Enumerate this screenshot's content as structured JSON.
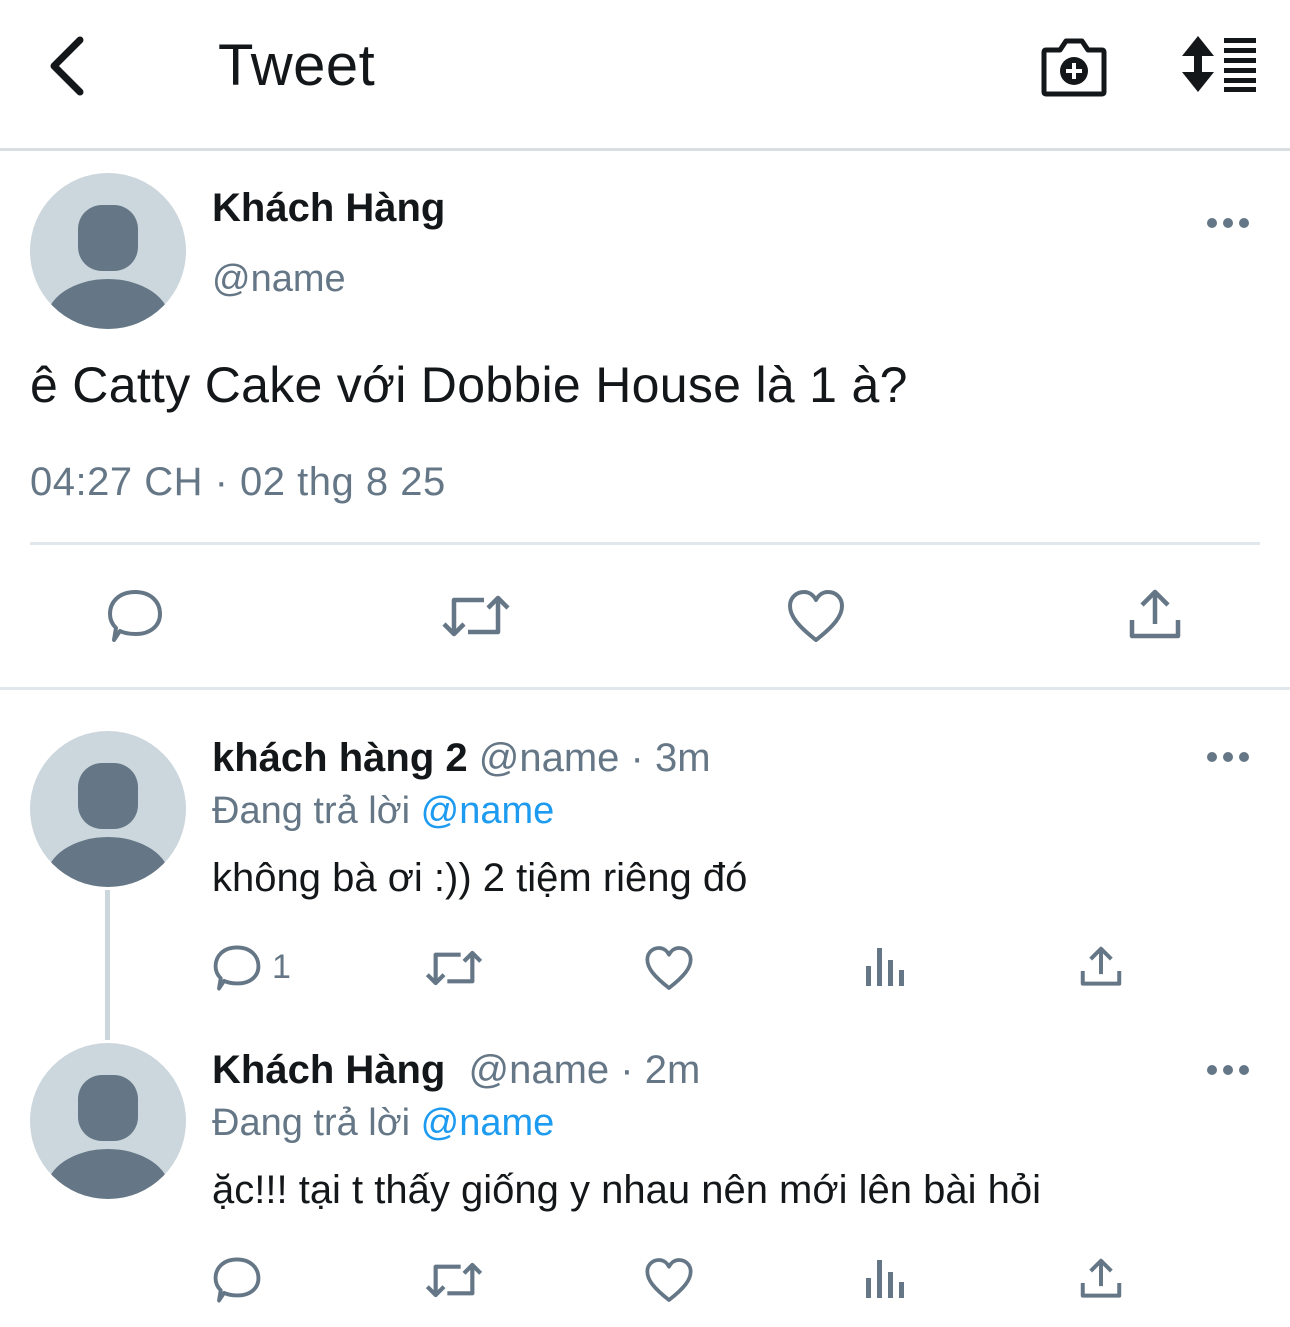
{
  "header": {
    "title": "Tweet",
    "back_icon": "chevron-left-icon",
    "camera_icon": "camera-add-icon",
    "sort_icon": "sort-lines-icon"
  },
  "main_tweet": {
    "name": "Khách Hàng",
    "handle": "@name",
    "text": "ê Catty Cake với Dobbie House là 1 à?",
    "timestamp": "04:27 CH · 02 thg 8 25"
  },
  "replies": [
    {
      "name": "khách hàng 2",
      "handle": "@name",
      "time": "· 3m",
      "replying_label": "Đang trả lời",
      "replying_to": "@name",
      "text": "không bà ơi :)) 2 tiệm riêng đó",
      "reply_count": "1"
    },
    {
      "name": "Khách Hàng",
      "handle": "@name",
      "time": "· 2m",
      "replying_label": "Đang trả lời",
      "replying_to": "@name",
      "text": "ặc!!! tại t thấy giống y nhau nên mới lên bài hỏi",
      "reply_count": ""
    }
  ],
  "colors": {
    "text": "#14171a",
    "secondary": "#657786",
    "mention": "#1d9bf0",
    "avatar_bg": "#ccd6dd",
    "avatar_fg": "#657786"
  }
}
